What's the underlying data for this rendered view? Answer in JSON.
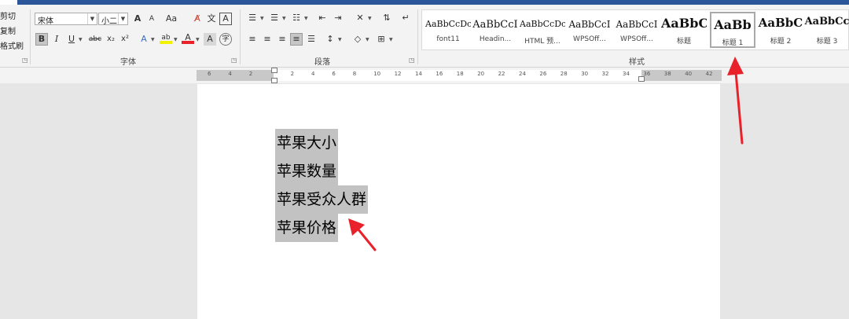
{
  "clipboard": {
    "cut_label": "剪切",
    "copy_label": "复制",
    "format_painter_label": "格式刷"
  },
  "font_group": {
    "label": "字体",
    "font_name": "宋体",
    "font_size": "小二",
    "grow_icon": "A",
    "shrink_icon": "A",
    "case_label": "Aa",
    "phonetic_icon": "文",
    "border_icon": "A",
    "bold_label": "B",
    "italic_label": "I",
    "underline_label": "U",
    "strike_label": "abc",
    "subscript_label": "x₂",
    "superscript_label": "x²",
    "effects_icon": "A",
    "highlight_icon": "ab",
    "font_color_icon": "A",
    "char_shading_icon": "A",
    "enclose_icon": "字"
  },
  "paragraph_group": {
    "label": "段落"
  },
  "styles_group": {
    "label": "样式",
    "items": [
      {
        "preview": "AaBbCcDc",
        "name": "font11"
      },
      {
        "preview": "AaBbCcI",
        "name": "Headin..."
      },
      {
        "preview": "AaBbCcDc",
        "name": "HTML 预..."
      },
      {
        "preview": "AaBbCcI",
        "name": "WPSOff..."
      },
      {
        "preview": "AaBbCcI",
        "name": "WPSOff..."
      },
      {
        "preview": "AaBbC",
        "name": "标题"
      },
      {
        "preview": "AaBb",
        "name": "标题 1",
        "selected": true
      },
      {
        "preview": "AaBbC",
        "name": "标题 2"
      },
      {
        "preview": "AaBbCc",
        "name": "标题 3"
      }
    ]
  },
  "ruler": {
    "ticks": [
      "6",
      "4",
      "2",
      "",
      "2",
      "4",
      "6",
      "8",
      "10",
      "12",
      "14",
      "16",
      "18",
      "20",
      "22",
      "24",
      "26",
      "28",
      "30",
      "32",
      "34",
      "36",
      "38",
      "40",
      "42"
    ]
  },
  "document": {
    "lines": [
      "苹果大小",
      "苹果数量",
      "苹果受众人群",
      "苹果价格"
    ]
  },
  "annotation_color": "#e8212b",
  "accent_color": "#2b579a"
}
